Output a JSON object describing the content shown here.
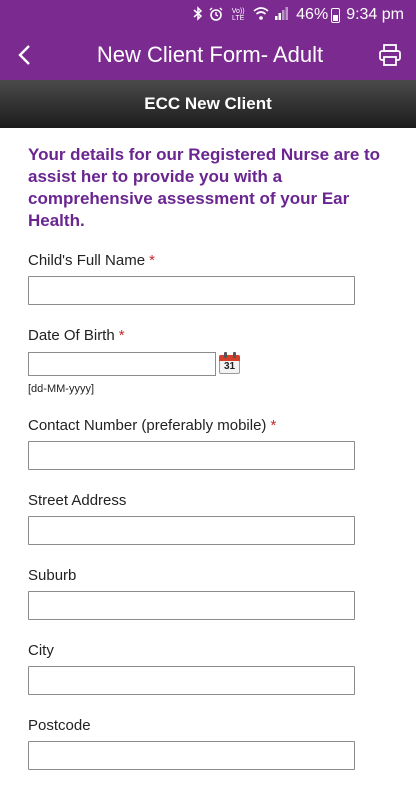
{
  "status_bar": {
    "battery_percent": "46%",
    "time": "9:34 pm",
    "network_label": "Vo)) LTE",
    "icons": [
      "bluetooth-icon",
      "alarm-icon",
      "volte-icon",
      "wifi-icon",
      "signal-icon",
      "battery-icon"
    ]
  },
  "app_bar": {
    "title": "New Client Form- Adult",
    "back_icon": "chevron-left-icon",
    "print_icon": "printer-icon"
  },
  "section": {
    "title": "ECC New Client"
  },
  "form": {
    "intro": "Your details for our Registered Nurse are to assist her to provide you with a comprehensive assessment of your Ear Health.",
    "required_mark": "*",
    "fields": [
      {
        "label": "Child's Full Name",
        "required": true,
        "value": ""
      },
      {
        "label": "Date Of Birth",
        "required": true,
        "value": "",
        "hint": "[dd-MM-yyyy]",
        "calendar_day": "31"
      },
      {
        "label": "Contact Number (preferably mobile)",
        "required": true,
        "value": ""
      },
      {
        "label": "Street Address",
        "required": false,
        "value": ""
      },
      {
        "label": "Suburb",
        "required": false,
        "value": ""
      },
      {
        "label": "City",
        "required": false,
        "value": ""
      },
      {
        "label": "Postcode",
        "required": false,
        "value": ""
      }
    ]
  },
  "colors": {
    "brand_purple": "#7b2b90",
    "intro_text": "#6a2590",
    "required": "#c62828"
  }
}
